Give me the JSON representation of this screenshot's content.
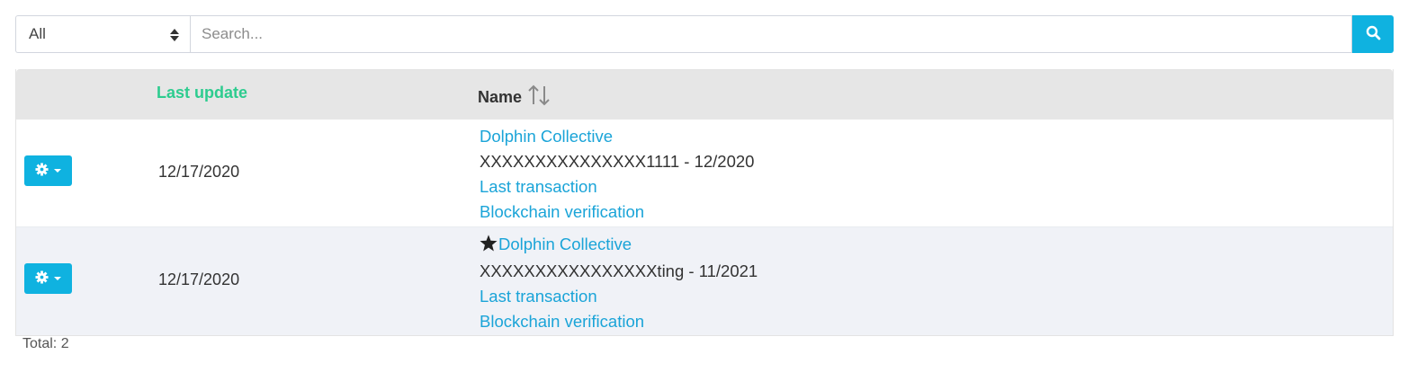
{
  "filter": {
    "selected": "All",
    "search_placeholder": "Search..."
  },
  "table": {
    "columns": {
      "last_update": "Last update",
      "name": "Name"
    },
    "rows": [
      {
        "date": "12/17/2020",
        "starred": false,
        "name": "Dolphin Collective",
        "detail": "XXXXXXXXXXXXXXX1111 - 12/2020",
        "link_transaction": "Last transaction",
        "link_verification": "Blockchain verification"
      },
      {
        "date": "12/17/2020",
        "starred": true,
        "name": "Dolphin Collective",
        "detail": "XXXXXXXXXXXXXXXXting - 11/2021",
        "link_transaction": "Last transaction",
        "link_verification": "Blockchain verification"
      }
    ]
  },
  "footer": {
    "total": "Total: 2"
  },
  "icons": {
    "search": "search-icon",
    "gear": "gear-icon",
    "star": "star-icon",
    "sort": "sort-icon"
  },
  "colors": {
    "accent": "#0fb2e0",
    "link": "#1aa4d8",
    "sorted_header": "#2dcc8f",
    "header_bg": "#e6e6e6",
    "striped_row": "#f0f2f7"
  }
}
